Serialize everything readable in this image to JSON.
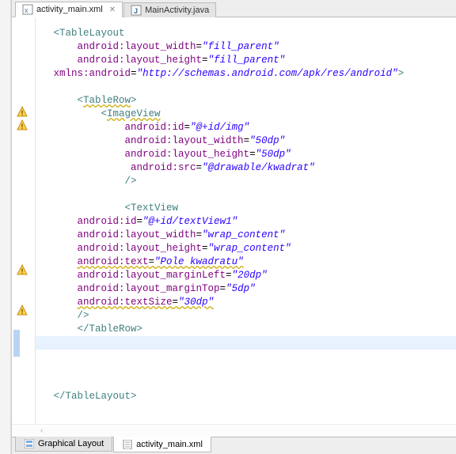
{
  "editor": {
    "tabs": [
      {
        "label": "activity_main.xml",
        "icon": "xml"
      },
      {
        "label": "MainActivity.java",
        "icon": "java"
      }
    ],
    "bottom_tabs": [
      {
        "label": "Graphical Layout"
      },
      {
        "label": "activity_main.xml"
      }
    ]
  },
  "code": {
    "indent1": "   ",
    "indent2": "       ",
    "indent3": "           ",
    "indent4": "               ",
    "indent4b": "                ",
    "lt": "<",
    "gt": ">",
    "lts": "</",
    "eq": "=",
    "slashgt": "/>",
    "tag_TableLayout": "TableLayout",
    "tag_TableRow": "TableRow",
    "tag_ImageView": "ImageView",
    "tag_TextView": "TextView",
    "attr_layout_width": "android:layout_width",
    "attr_layout_height": "android:layout_height",
    "attr_xmlns": "xmlns:android",
    "attr_id": "android:id",
    "attr_src": "android:src",
    "attr_text": "android:text",
    "attr_marginLeft": "android:layout_marginLeft",
    "attr_marginTop": "android:layout_marginTop",
    "attr_textSize": "android:textSize",
    "val_fill_parent": "\"fill_parent\"",
    "val_ns": "\"http://schemas.android.com/apk/res/android\"",
    "val_img_id": "\"@+id/img\"",
    "val_50dp": "\"50dp\"",
    "val_src": "\"@drawable/kwadrat\"",
    "val_textview_id": "\"@+id/textView1\"",
    "val_wrap": "\"wrap_content\"",
    "val_text": "\"Pole kwadratu\"",
    "val_20dp": "\"20dp\"",
    "val_5dp": "\"5dp\"",
    "val_30dp": "\"30dp\""
  },
  "warnings": {
    "positions": [
      112,
      129,
      312,
      363
    ]
  }
}
